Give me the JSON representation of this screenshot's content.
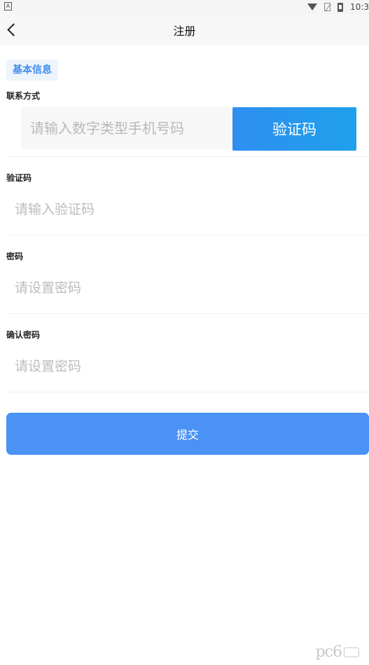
{
  "status_bar": {
    "left_icon_label": "A",
    "time": "10:3",
    "icons": [
      "wifi-icon",
      "no-sim-icon",
      "battery-icon"
    ]
  },
  "nav": {
    "title": "注册",
    "back_icon": "chevron-left-icon"
  },
  "form": {
    "section_title": "基本信息",
    "phone": {
      "label": "联系方式",
      "placeholder": "请输入数字类型手机号码",
      "code_button": "验证码"
    },
    "code": {
      "label": "验证码",
      "placeholder": "请输入验证码"
    },
    "password": {
      "label": "密码",
      "placeholder": "请设置密码"
    },
    "confirm_password": {
      "label": "确认密码",
      "placeholder": "请设置密码"
    },
    "submit_label": "提交"
  },
  "watermark": {
    "text": "pc6"
  },
  "colors": {
    "accent": "#4a92f5",
    "code_button_start": "#2f8ff0",
    "code_button_end": "#1fa0ea",
    "section_tag_text": "#3f8ef0",
    "section_tag_bg": "#eef4fb"
  }
}
